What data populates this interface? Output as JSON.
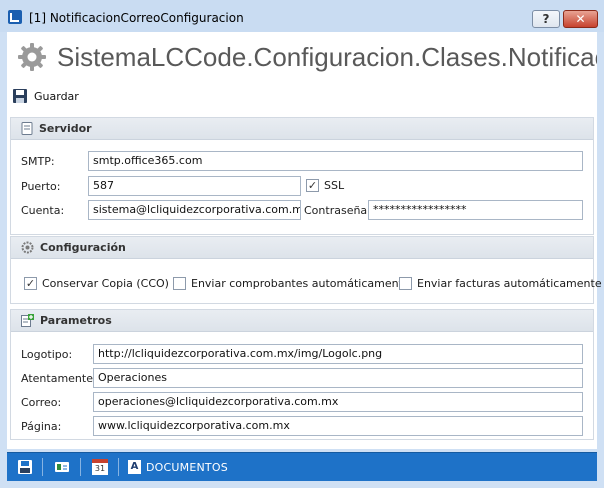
{
  "window": {
    "title": "[1] NotificacionCorreoConfiguracion",
    "help_label": "?",
    "close_label": "✕"
  },
  "header": {
    "title": "SistemaLCCode.Configuracion.Clases.NotificacionCorreoConfiguracion"
  },
  "toolbar": {
    "save_label": "Guardar"
  },
  "servidor": {
    "title": "Servidor",
    "smtp_label": "SMTP:",
    "smtp_value": "smtp.office365.com",
    "puerto_label": "Puerto:",
    "puerto_value": "587",
    "ssl_label": "SSL",
    "ssl_checked": true,
    "cuenta_label": "Cuenta:",
    "cuenta_value": "sistema@lcliquidezcorporativa.com.mx",
    "password_label": "Contraseña:",
    "password_value": "*****************"
  },
  "configuracion": {
    "title": "Configuración",
    "cco_label": "Conservar Copia (CCO)",
    "cco_checked": true,
    "comprobantes_label": "Enviar comprobantes automáticamente",
    "comprobantes_checked": false,
    "facturas_label": "Enviar facturas automáticamente",
    "facturas_checked": false
  },
  "parametros": {
    "title": "Parametros",
    "logotipo_label": "Logotipo:",
    "logotipo_value": "http://lcliquidezcorporativa.com.mx/img/Logolc.png",
    "atentamente_label": "Atentamente:",
    "atentamente_value": "Operaciones",
    "correo_label": "Correo:",
    "correo_value": "operaciones@lcliquidezcorporativa.com.mx",
    "pagina_label": "Página:",
    "pagina_value": "www.lcliquidezcorporativa.com.mx"
  },
  "statusbar": {
    "calendar_day": "31",
    "documentos_label": "DOCUMENTOS"
  },
  "colors": {
    "accent": "#1e72c8",
    "titlebar": "#c9dcf2",
    "close": "#c7422e"
  },
  "icons": [
    "app-icon",
    "help-icon",
    "close-icon",
    "gear-icon",
    "save-icon",
    "server-icon",
    "settings-icon",
    "add-params-icon",
    "floppy-icon",
    "id-card-icon",
    "calendar-icon",
    "documents-icon"
  ]
}
